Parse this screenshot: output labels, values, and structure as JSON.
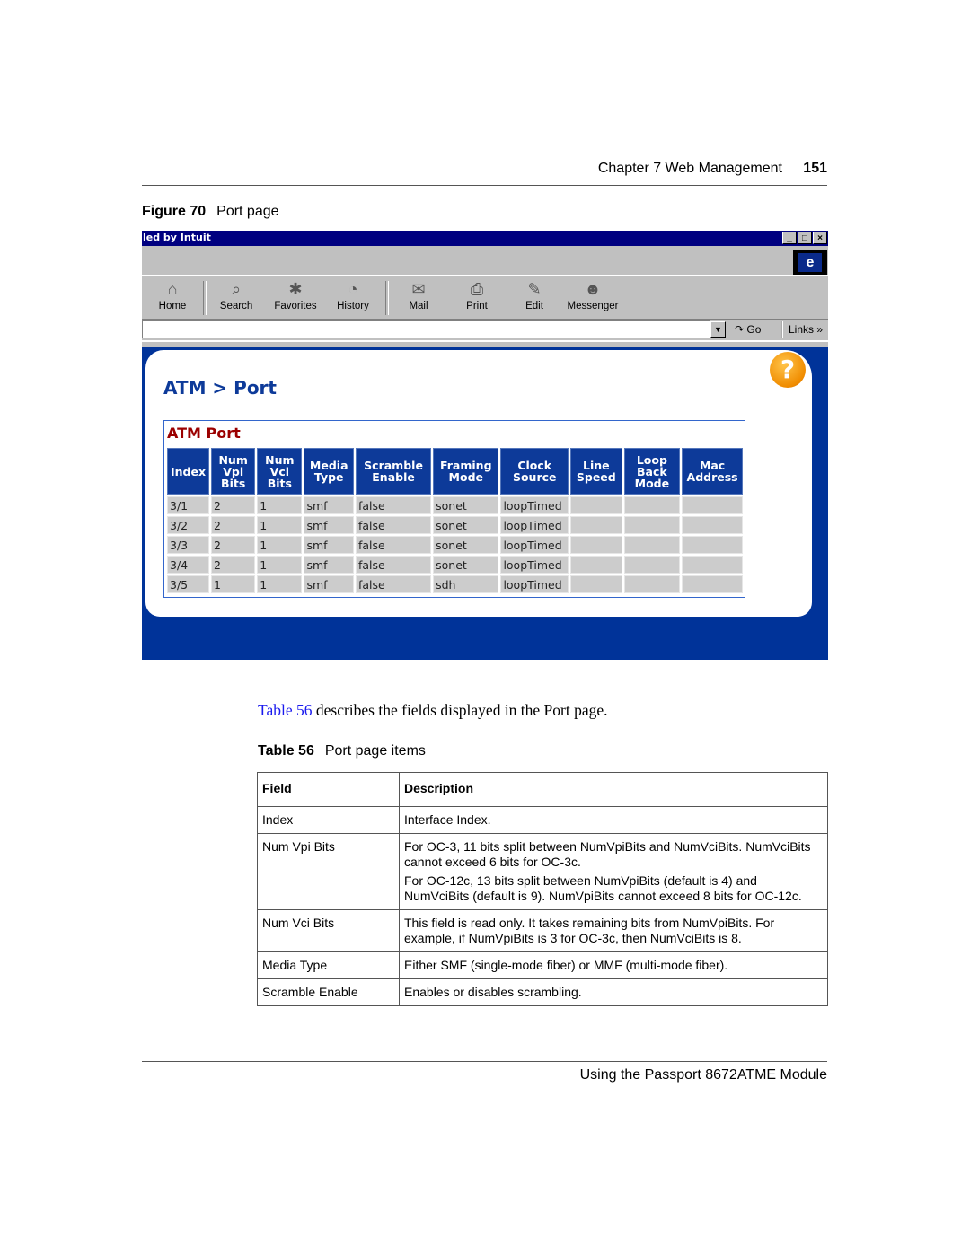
{
  "running_head": {
    "chapter": "Chapter 7  Web Management",
    "page_number": "151"
  },
  "figure": {
    "label": "Figure 70",
    "title": "Port page"
  },
  "browser": {
    "title_fragment": "led by Intuit",
    "window_buttons": {
      "minimize": "_",
      "maximize": "□",
      "close": "×"
    },
    "brand_logo": "e",
    "toolbar": [
      {
        "id": "home",
        "label": "Home",
        "icon": "home-icon",
        "glyph": "⌂"
      },
      {
        "id": "search",
        "label": "Search",
        "icon": "search-icon",
        "glyph": "⌕"
      },
      {
        "id": "favorites",
        "label": "Favorites",
        "icon": "favorites-folder-icon",
        "glyph": "✱"
      },
      {
        "id": "history",
        "label": "History",
        "icon": "history-icon",
        "glyph": "◔"
      },
      {
        "id": "mail",
        "label": "Mail",
        "icon": "mail-icon",
        "glyph": "✉"
      },
      {
        "id": "print",
        "label": "Print",
        "icon": "print-icon",
        "glyph": "⎙"
      },
      {
        "id": "edit",
        "label": "Edit",
        "icon": "edit-icon",
        "glyph": "✎"
      },
      {
        "id": "messenger",
        "label": "Messenger",
        "icon": "messenger-icon",
        "glyph": "☻"
      }
    ],
    "address": {
      "value": "",
      "go_label": "Go",
      "links_label": "Links",
      "more": "»",
      "dropdown": "▼",
      "go_glyph": "↷"
    }
  },
  "web_page": {
    "breadcrumb": "ATM > Port",
    "help_glyph": "?",
    "panel_title": "ATM Port",
    "columns": [
      "Index",
      "Num Vpi Bits",
      "Num Vci Bits",
      "Media Type",
      "Scramble Enable",
      "Framing Mode",
      "Clock Source",
      "Line Speed",
      "Loop Back Mode",
      "Mac Address"
    ],
    "rows": [
      [
        "3/1",
        "2",
        "1",
        "smf",
        "false",
        "sonet",
        "loopTimed",
        "",
        "",
        ""
      ],
      [
        "3/2",
        "2",
        "1",
        "smf",
        "false",
        "sonet",
        "loopTimed",
        "",
        "",
        ""
      ],
      [
        "3/3",
        "2",
        "1",
        "smf",
        "false",
        "sonet",
        "loopTimed",
        "",
        "",
        ""
      ],
      [
        "3/4",
        "2",
        "1",
        "smf",
        "false",
        "sonet",
        "loopTimed",
        "",
        "",
        ""
      ],
      [
        "3/5",
        "1",
        "1",
        "smf",
        "false",
        "sdh",
        "loopTimed",
        "",
        "",
        ""
      ]
    ]
  },
  "intro": {
    "xref": "Table 56",
    "text": " describes the fields displayed in the Port page."
  },
  "table_caption": {
    "label": "Table 56",
    "title": "Port page items"
  },
  "description_table": {
    "headers": [
      "Field",
      "Description"
    ],
    "rows": [
      {
        "field": "Index",
        "desc": [
          "Interface Index."
        ]
      },
      {
        "field": "Num Vpi Bits",
        "desc": [
          "For OC-3, 11 bits split between NumVpiBits and NumVciBits. NumVciBits cannot exceed 6 bits for OC-3c.",
          "For OC-12c, 13 bits split between NumVpiBits (default is 4) and NumVciBits (default is 9). NumVpiBits cannot exceed 8 bits for OC-12c."
        ]
      },
      {
        "field": "Num Vci Bits",
        "desc": [
          "This field is read only. It takes remaining bits from NumVpiBits. For example, if NumVpiBits is 3 for OC-3c, then NumVciBits is 8."
        ]
      },
      {
        "field": "Media Type",
        "desc": [
          "Either SMF (single-mode fiber) or MMF (multi-mode fiber)."
        ]
      },
      {
        "field": "Scramble Enable",
        "desc": [
          "Enables or disables scrambling."
        ]
      }
    ]
  },
  "footer": {
    "text": "Using the Passport 8672ATME Module"
  },
  "colors": {
    "title_bar": "#000080",
    "content_bg": "#003399",
    "header_cell": "#0d3a99",
    "data_cell": "#cccccc",
    "panel_title": "#9b0000",
    "xref": "#1a1aee",
    "help": "#f08c00"
  }
}
